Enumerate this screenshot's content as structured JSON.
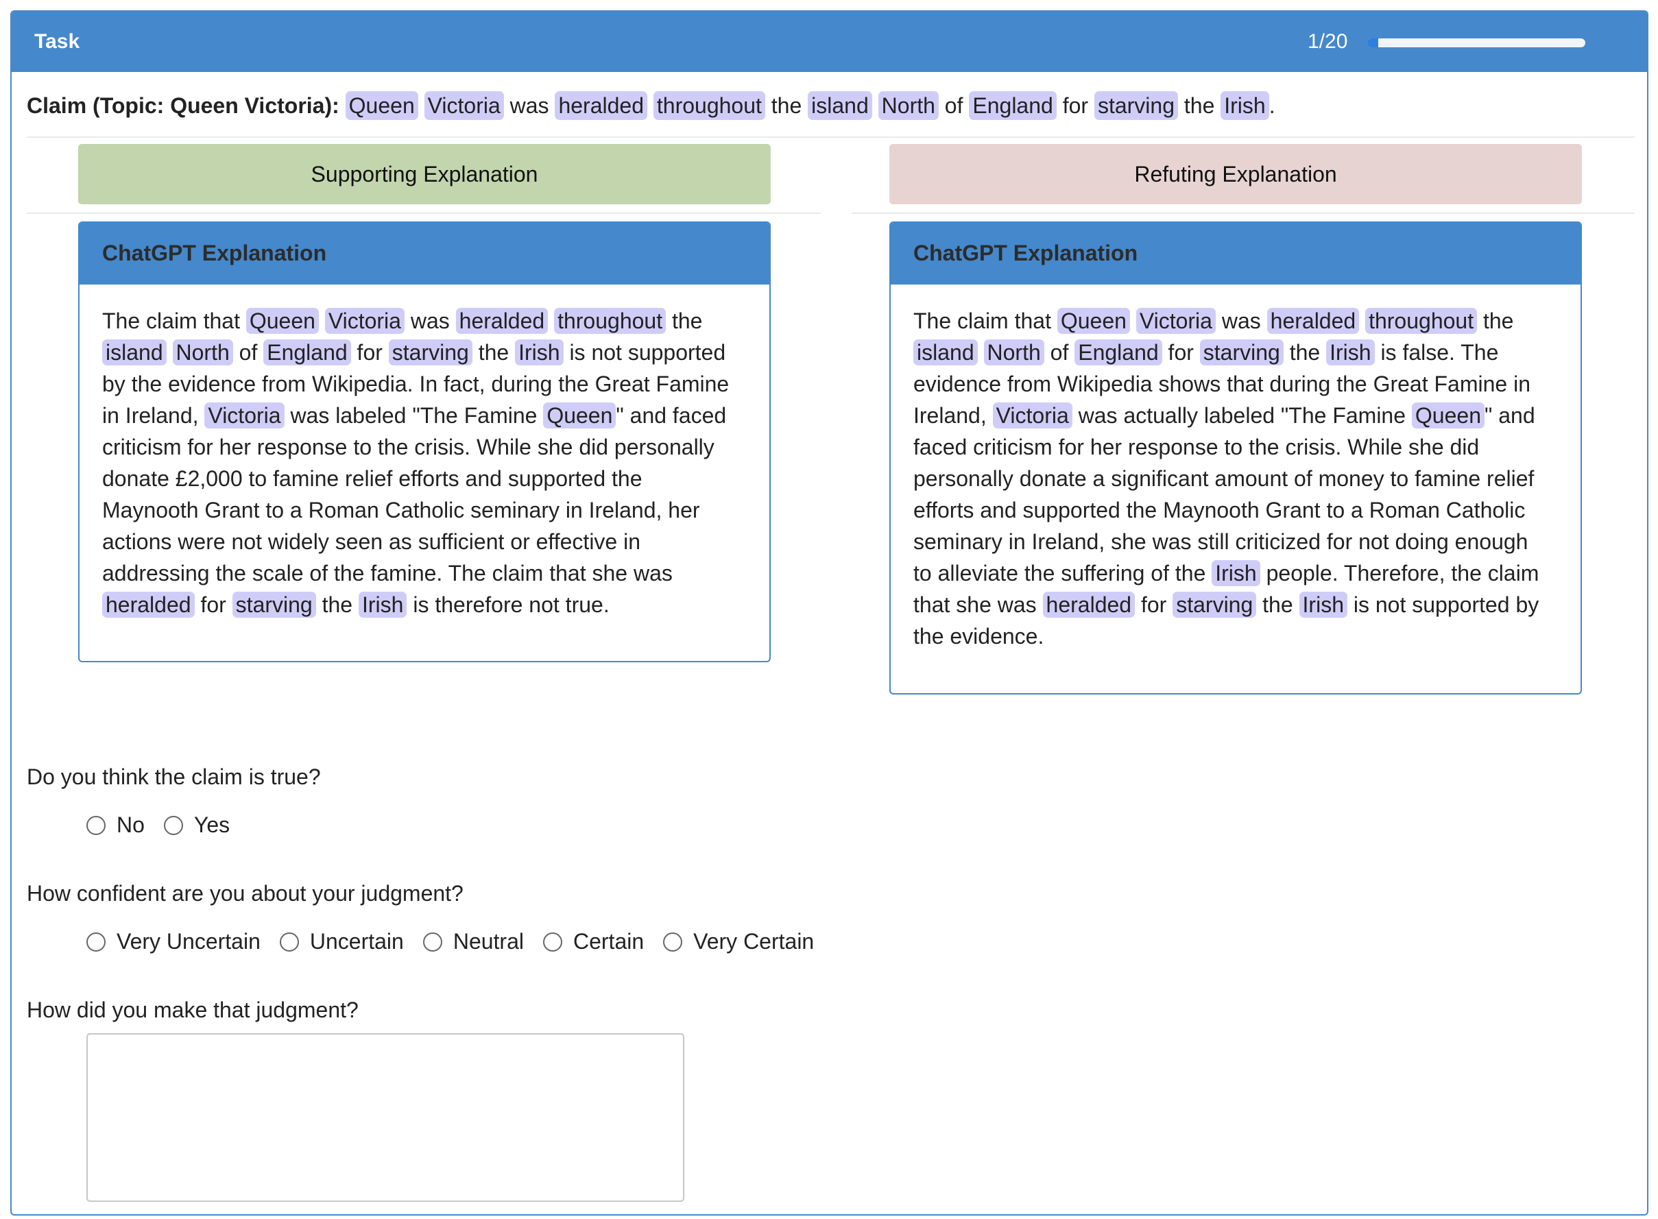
{
  "header": {
    "title": "Task",
    "progress_label": "1/20",
    "progress_fraction": 0.05
  },
  "claim": {
    "label": "Claim (Topic: Queen Victoria):",
    "segments": [
      {
        "t": "Queen",
        "hl": true
      },
      {
        "t": " ",
        "hl": false
      },
      {
        "t": "Victoria",
        "hl": true
      },
      {
        "t": " was ",
        "hl": false
      },
      {
        "t": "heralded",
        "hl": true
      },
      {
        "t": " ",
        "hl": false
      },
      {
        "t": "throughout",
        "hl": true
      },
      {
        "t": " the ",
        "hl": false
      },
      {
        "t": "island",
        "hl": true
      },
      {
        "t": " ",
        "hl": false
      },
      {
        "t": "North",
        "hl": true
      },
      {
        "t": " of ",
        "hl": false
      },
      {
        "t": "England",
        "hl": true
      },
      {
        "t": " for ",
        "hl": false
      },
      {
        "t": "starving",
        "hl": true
      },
      {
        "t": " the ",
        "hl": false
      },
      {
        "t": "Irish",
        "hl": true
      },
      {
        "t": ".",
        "hl": false
      }
    ]
  },
  "buttons": {
    "support": "Supporting Explanation",
    "refute": "Refuting Explanation"
  },
  "explanations": {
    "left": {
      "title": "ChatGPT Explanation",
      "lines": [
        [
          {
            "t": "The claim that ",
            "hl": false
          },
          {
            "t": "Queen",
            "hl": true
          },
          {
            "t": " ",
            "hl": false
          },
          {
            "t": "Victoria",
            "hl": true
          },
          {
            "t": " was ",
            "hl": false
          },
          {
            "t": "heralded",
            "hl": true
          },
          {
            "t": " ",
            "hl": false
          },
          {
            "t": "throughout",
            "hl": true
          },
          {
            "t": " the",
            "hl": false
          }
        ],
        [
          {
            "t": "island",
            "hl": true
          },
          {
            "t": " ",
            "hl": false
          },
          {
            "t": "North",
            "hl": true
          },
          {
            "t": " of ",
            "hl": false
          },
          {
            "t": "England",
            "hl": true
          },
          {
            "t": " for ",
            "hl": false
          },
          {
            "t": "starving",
            "hl": true
          },
          {
            "t": " the ",
            "hl": false
          },
          {
            "t": "Irish",
            "hl": true
          },
          {
            "t": " is not supported",
            "hl": false
          }
        ],
        [
          {
            "t": "by the evidence from Wikipedia. In fact, during the Great Famine",
            "hl": false
          }
        ],
        [
          {
            "t": "in Ireland, ",
            "hl": false
          },
          {
            "t": "Victoria",
            "hl": true
          },
          {
            "t": " was labeled \"The Famine ",
            "hl": false
          },
          {
            "t": "Queen",
            "hl": true
          },
          {
            "t": "\" and faced",
            "hl": false
          }
        ],
        [
          {
            "t": "criticism for her response to the crisis. While she did personally",
            "hl": false
          }
        ],
        [
          {
            "t": "donate £2,000 to famine relief efforts and supported the",
            "hl": false
          }
        ],
        [
          {
            "t": "Maynooth Grant to a Roman Catholic seminary in Ireland, her",
            "hl": false
          }
        ],
        [
          {
            "t": "actions were not widely seen as sufficient or effective in",
            "hl": false
          }
        ],
        [
          {
            "t": "addressing the scale of the famine. The claim that she was",
            "hl": false
          }
        ],
        [
          {
            "t": "heralded",
            "hl": true
          },
          {
            "t": " for ",
            "hl": false
          },
          {
            "t": "starving",
            "hl": true
          },
          {
            "t": " the ",
            "hl": false
          },
          {
            "t": "Irish",
            "hl": true
          },
          {
            "t": " is therefore not true.",
            "hl": false
          }
        ]
      ]
    },
    "right": {
      "title": "ChatGPT Explanation",
      "lines": [
        [
          {
            "t": "The claim that ",
            "hl": false
          },
          {
            "t": "Queen",
            "hl": true
          },
          {
            "t": " ",
            "hl": false
          },
          {
            "t": "Victoria",
            "hl": true
          },
          {
            "t": " was ",
            "hl": false
          },
          {
            "t": "heralded",
            "hl": true
          },
          {
            "t": " ",
            "hl": false
          },
          {
            "t": "throughout",
            "hl": true
          },
          {
            "t": " the",
            "hl": false
          }
        ],
        [
          {
            "t": "island",
            "hl": true
          },
          {
            "t": " ",
            "hl": false
          },
          {
            "t": "North",
            "hl": true
          },
          {
            "t": " of ",
            "hl": false
          },
          {
            "t": "England",
            "hl": true
          },
          {
            "t": " for ",
            "hl": false
          },
          {
            "t": "starving",
            "hl": true
          },
          {
            "t": " the ",
            "hl": false
          },
          {
            "t": "Irish",
            "hl": true
          },
          {
            "t": " is false. The",
            "hl": false
          }
        ],
        [
          {
            "t": "evidence from Wikipedia shows that during the Great Famine in",
            "hl": false
          }
        ],
        [
          {
            "t": "Ireland, ",
            "hl": false
          },
          {
            "t": "Victoria",
            "hl": true
          },
          {
            "t": " was actually labeled \"The Famine ",
            "hl": false
          },
          {
            "t": "Queen",
            "hl": true
          },
          {
            "t": "\" and",
            "hl": false
          }
        ],
        [
          {
            "t": "faced criticism for her response to the crisis. While she did",
            "hl": false
          }
        ],
        [
          {
            "t": "personally donate a significant amount of money to famine relief",
            "hl": false
          }
        ],
        [
          {
            "t": "efforts and supported the Maynooth Grant to a Roman Catholic",
            "hl": false
          }
        ],
        [
          {
            "t": "seminary in Ireland, she was still criticized for not doing enough",
            "hl": false
          }
        ],
        [
          {
            "t": "to alleviate the suffering of the ",
            "hl": false
          },
          {
            "t": "Irish",
            "hl": true
          },
          {
            "t": " people. Therefore, the claim",
            "hl": false
          }
        ],
        [
          {
            "t": "that she was ",
            "hl": false
          },
          {
            "t": "heralded",
            "hl": true
          },
          {
            "t": " for ",
            "hl": false
          },
          {
            "t": "starving",
            "hl": true
          },
          {
            "t": " the ",
            "hl": false
          },
          {
            "t": "Irish",
            "hl": true
          },
          {
            "t": " is not supported by",
            "hl": false
          }
        ],
        [
          {
            "t": "the evidence.",
            "hl": false
          }
        ]
      ]
    }
  },
  "questions": {
    "q1": "Do you think the claim is true?",
    "q1_options": [
      "No",
      "Yes"
    ],
    "q2": "How confident are you about your judgment?",
    "q2_options": [
      "Very Uncertain",
      "Uncertain",
      "Neutral",
      "Certain",
      "Very Certain"
    ],
    "q3": "How did you make that judgment?",
    "q3_value": ""
  },
  "colors": {
    "header": "#4588cb",
    "highlight": "#cfcdf8",
    "support": "#c2d5ad",
    "refute": "#e7d4d2"
  }
}
